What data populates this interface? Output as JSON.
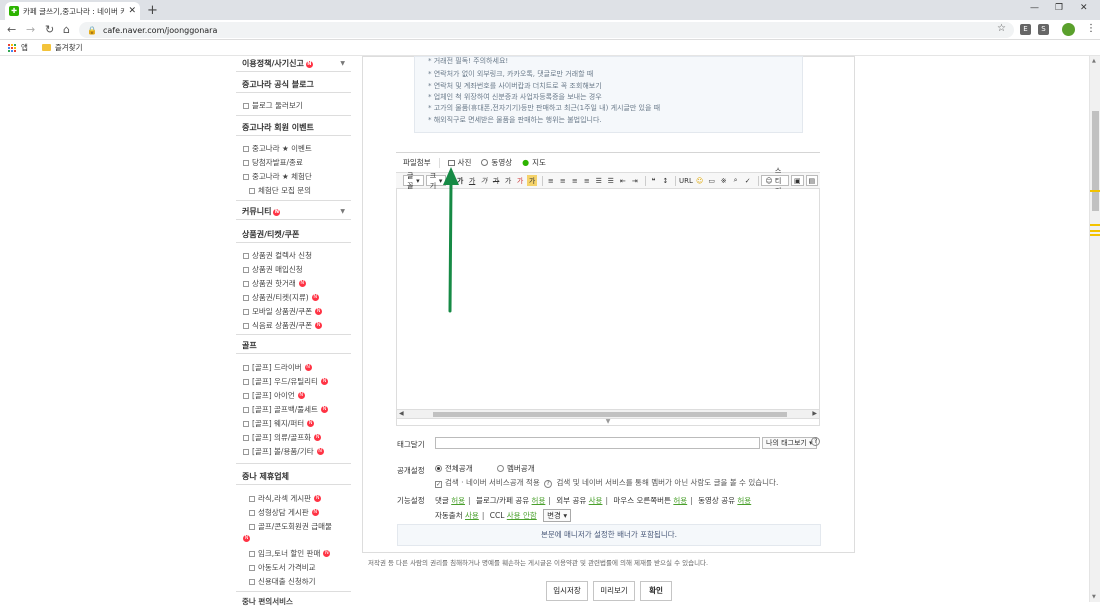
{
  "browser": {
    "tab_title": "카페 글쓰기,중고나라 : 네이버 카",
    "url": "cafe.naver.com/joonggonara",
    "bookmarks": [
      {
        "label": "앱"
      },
      {
        "label": "즐겨찾기"
      }
    ],
    "ext1": "E",
    "ext2": "S"
  },
  "sidebar": {
    "top_section": "이용정책/사기신고",
    "blog_title": "중고나라 공식 블로그",
    "blog_items": [
      "블로그 둘러보기"
    ],
    "event_title": "중고나라 회원 이벤트",
    "event_items": [
      "중고나라 ★ 이벤트",
      "당첨자발표/종료",
      "중고나라 ★ 체험단",
      "체험단 모집 문의"
    ],
    "community_title": "커뮤니티",
    "voucher_title": "상품권/티켓/쿠폰",
    "voucher_items": [
      "상품권 컬렉사 신청",
      "상품권 매입신청",
      "상품권 핫거래",
      "상품권/티켓(지류)",
      "모바일 상품권/쿠폰",
      "식음료 상품권/쿠폰"
    ],
    "golf_title": "골프",
    "golf_items": [
      "[골프] 드라이버",
      "[골프] 우드/유틸리티",
      "[골프] 아이언",
      "[골프] 골프백/풀세트",
      "[골프] 웨지/퍼터",
      "[골프] 의류/골프화",
      "[골프] 볼/용품/기타"
    ],
    "partner_title": "중나 제휴업체",
    "partner_items": [
      "라식,라섹 게시판",
      "성형상담 게시판",
      "골프/콘도회원권 급매물",
      "임크,토너 할인 판매",
      "아동도서 가격비교",
      "신용대출 신청하기"
    ],
    "bottom_cut": "중나 편의서비스",
    "new_badge": "N"
  },
  "notice_lines": [
    "* 거래전 필독! 주의하세요!",
    "* 연락처가 없이 외부링크, 카카오톡, 댓글로만 거래할 때",
    "* 연락처 및 계좌번호를 사이버캅과 더치트로 꼭 조회해보기",
    "* 업체인 척 위장하여 신분증과 사업자등록증을 보내는 경우",
    "* 고가의 물품(휴대폰,전자기기)등만 판매하고 최근(1주일 내) 게시글만 있을 때",
    "* 해외직구로 면세받은 물품을 판매하는 행위는 불법입니다."
  ],
  "attach_bar": {
    "label": "파일첨부",
    "photo": "사진",
    "video": "동영상",
    "map": "지도"
  },
  "format_bar": {
    "font": "글꼴",
    "size": "크기",
    "b": "가",
    "i": "가",
    "u": "가",
    "s": "가",
    "sup": "가",
    "color": "가",
    "bg": "가",
    "url": "URL",
    "sticker": "스티커"
  },
  "tag": {
    "label": "태그달기",
    "btn": "나의 태그보기",
    "help": "?"
  },
  "visibility": {
    "label": "공개설정",
    "public": "전체공개",
    "members": "멤버공개",
    "search_check": "검색 · 네이버 서비스공개 적용",
    "search_help": "?",
    "search_note": "검색 및 네이버 서비스를 통해 멤버가 아닌 사람도 글을 볼 수 있습니다."
  },
  "features": {
    "label": "기능설정",
    "items": [
      {
        "name": "댓글",
        "val": "허용"
      },
      {
        "name": "블로그/카페 공유",
        "val": "허용"
      },
      {
        "name": "외부 공유",
        "val": "사용"
      },
      {
        "name": "마우스 오른쪽버튼",
        "val": "허용"
      },
      {
        "name": "동영상 공유",
        "val": "허용"
      }
    ],
    "source_name": "자동출처",
    "source_val": "사용",
    "ccl_name": "CCL",
    "ccl_val": "사용 안함",
    "change_btn": "변경"
  },
  "banner": "본문에 매니저가 설정한 배너가 포함됩니다.",
  "copyright": "저작권 등 다른 사람의 권리를 침해하거나 명예를 훼손하는 게시글은 이용약관 및 관련법률에 의해 제재를 받으실 수 있습니다.",
  "buttons": {
    "temp_save": "임시저장",
    "preview": "미리보기",
    "confirm": "확인"
  },
  "colors": {
    "arrow": "#168a45",
    "naver_green": "#2db400"
  }
}
